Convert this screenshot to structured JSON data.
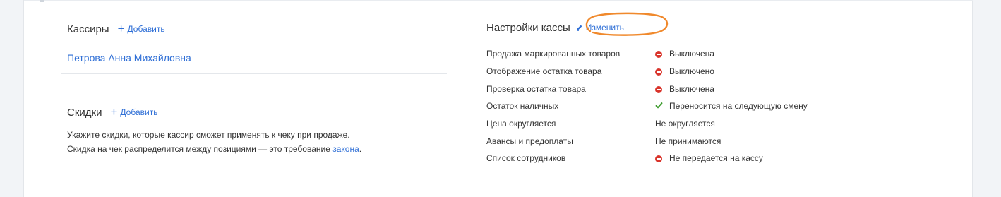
{
  "cashiers": {
    "title": "Кассиры",
    "add_label": "Добавить",
    "items": [
      "Петрова Анна Михайловна"
    ]
  },
  "discounts": {
    "title": "Скидки",
    "add_label": "Добавить",
    "description_line1": "Укажите скидки, которые кассир сможет применять к чеку при продаже.",
    "description_line2_prefix": "Скидка на чек распределится между позициями — это требование ",
    "description_law_link": "закона",
    "description_line2_suffix": "."
  },
  "settings": {
    "title": "Настройки кассы",
    "edit_label": "Изменить",
    "rows": [
      {
        "label": "Продажа маркированных товаров",
        "value": "Выключена",
        "status": "off"
      },
      {
        "label": "Отображение остатка товара",
        "value": "Выключено",
        "status": "off"
      },
      {
        "label": "Проверка остатка товара",
        "value": "Выключена",
        "status": "off"
      },
      {
        "label": "Остаток наличных",
        "value": "Переносится на следующую смену",
        "status": "check"
      },
      {
        "label": "Цена округляется",
        "value": "Не округляется",
        "status": "none"
      },
      {
        "label": "Авансы и предоплаты",
        "value": "Не принимаются",
        "status": "none"
      },
      {
        "label": "Список сотрудников",
        "value": "Не передается на кассу",
        "status": "off"
      }
    ]
  },
  "colors": {
    "link": "#2f6fd6",
    "off": "#d9342b",
    "on": "#3a9a2a",
    "highlight": "#f0892c"
  },
  "icons": {
    "add": "plus-icon",
    "edit": "pencil-icon",
    "off": "minus-circle-icon",
    "on": "checkmark-icon"
  }
}
